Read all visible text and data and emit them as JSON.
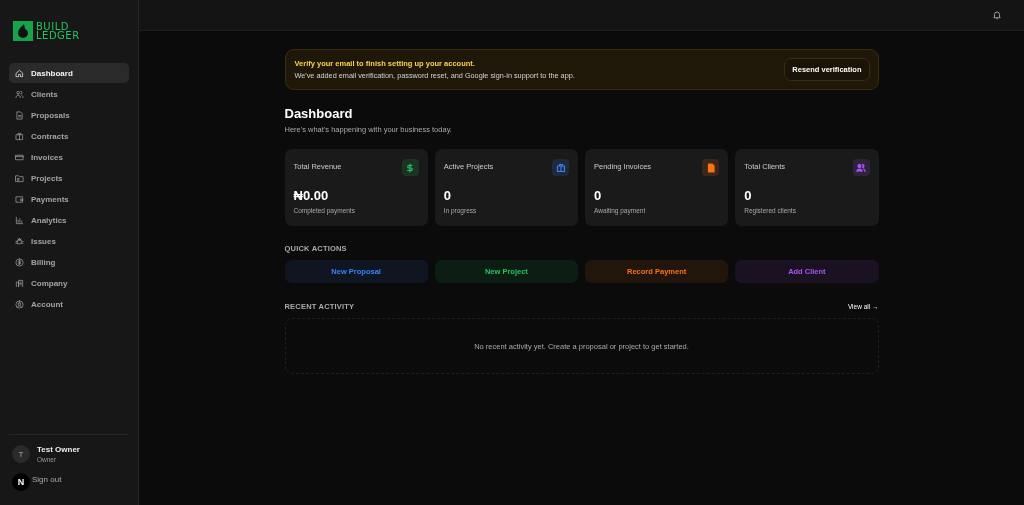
{
  "sidebar": {
    "logo": [
      "BUILD",
      "LEDGER"
    ],
    "items": [
      {
        "label": "Dashboard",
        "selected": true
      },
      {
        "label": "Clients",
        "selected": false
      },
      {
        "label": "Proposals",
        "selected": false
      },
      {
        "label": "Contracts",
        "selected": false
      },
      {
        "label": "Invoices",
        "selected": false
      },
      {
        "label": "Projects",
        "selected": false
      },
      {
        "label": "Payments",
        "selected": false
      },
      {
        "label": "Analytics",
        "selected": false
      },
      {
        "label": "Issues",
        "selected": false
      },
      {
        "label": "Billing",
        "selected": false
      },
      {
        "label": "Company",
        "selected": false
      },
      {
        "label": "Account",
        "selected": false
      }
    ],
    "user": {
      "initial": "T",
      "name": "Test Owner",
      "role": "Owner"
    },
    "sign_out": "Sign out",
    "dev_badge": "N"
  },
  "banner": {
    "title": "Verify your email to finish setting up your account.",
    "text": "We've added email verification, password reset, and Google sign-in support to the app.",
    "button": "Resend verification"
  },
  "page": {
    "title": "Dashboard",
    "subtitle": "Here's what's happening with your business today."
  },
  "stats": [
    {
      "label": "Total Revenue",
      "value": "₦0.00",
      "note": "Completed payments",
      "color": "#22c55e",
      "kind": "dollar"
    },
    {
      "label": "Active Projects",
      "value": "0",
      "note": "In progress",
      "color": "#3b82f6",
      "kind": "briefcase"
    },
    {
      "label": "Pending Invoices",
      "value": "0",
      "note": "Awaiting payment",
      "color": "#f97316",
      "kind": "file"
    },
    {
      "label": "Total Clients",
      "value": "0",
      "note": "Registered clients",
      "color": "#a855f7",
      "kind": "users"
    }
  ],
  "quick_actions": {
    "heading": "QUICK ACTIONS",
    "items": [
      {
        "label": "New Proposal",
        "color": "#3b82f6"
      },
      {
        "label": "New Project",
        "color": "#22c55e"
      },
      {
        "label": "Record Payment",
        "color": "#f97316"
      },
      {
        "label": "Add Client",
        "color": "#a855f7"
      }
    ]
  },
  "recent_activity": {
    "heading": "RECENT ACTIVITY",
    "link": "View all →",
    "empty": "No recent activity yet. Create a proposal or project to get started."
  }
}
